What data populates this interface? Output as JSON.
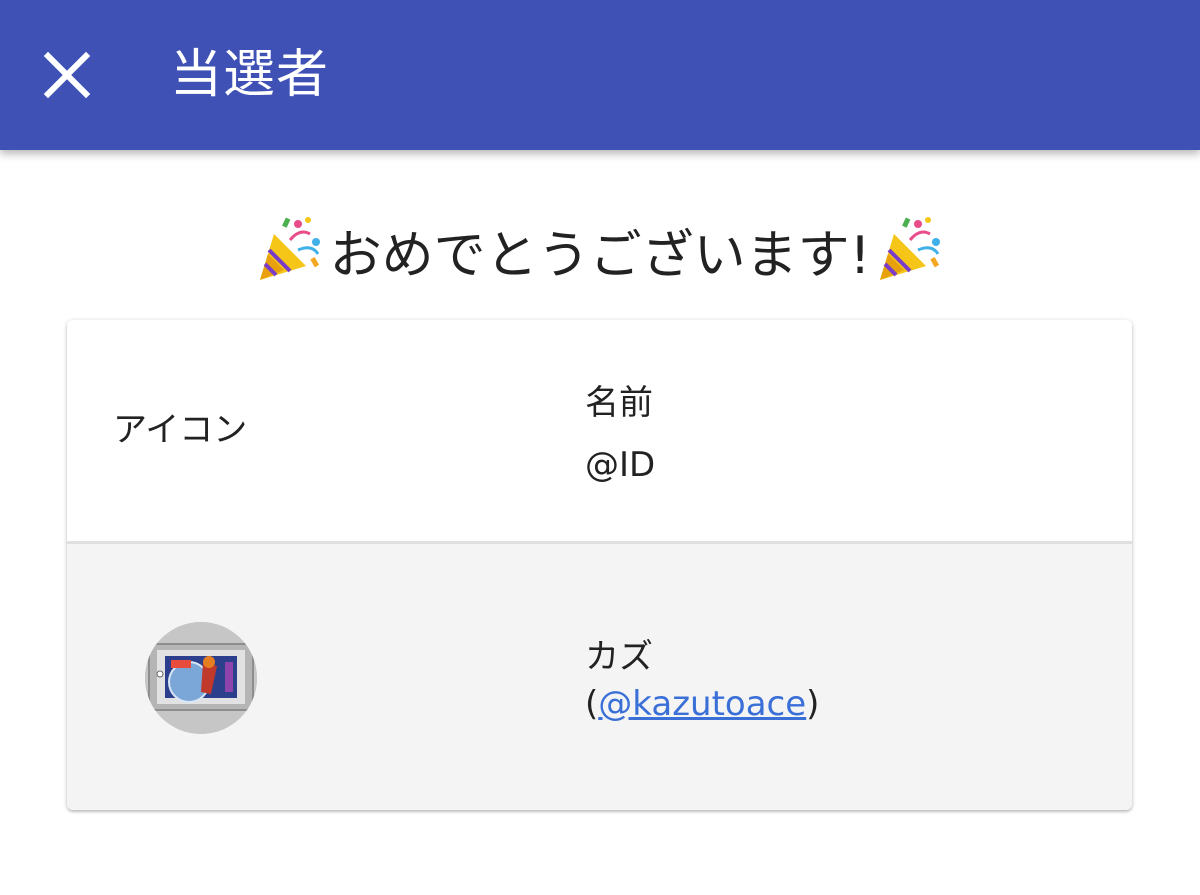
{
  "appbar": {
    "title": "当選者",
    "close_icon": "close-icon",
    "background": "#3f51b5"
  },
  "congrats": {
    "text": "おめでとうございます!",
    "icon": "party-popper-icon"
  },
  "table": {
    "headers": {
      "icon": "アイコン",
      "name": "名前",
      "id": "@ID"
    },
    "rows": [
      {
        "avatar": "avatar",
        "name": "カズ",
        "id_open": "(",
        "id": "@kazutoace",
        "id_close": ")"
      }
    ]
  },
  "colors": {
    "link": "#3a6fd8",
    "row_bg": "#f4f4f4"
  }
}
